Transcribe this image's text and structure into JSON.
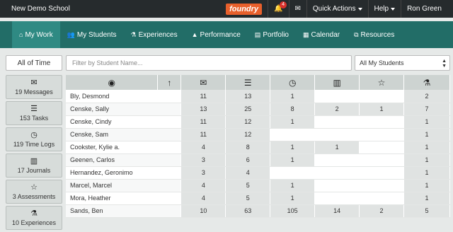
{
  "topbar": {
    "school": "New Demo School",
    "logo": "foundry",
    "notifications_count": "4",
    "quick_actions": "Quick Actions",
    "help": "Help",
    "user": "Ron Green"
  },
  "nav": {
    "tabs": [
      {
        "label": "My Work",
        "icon": "home-icon",
        "glyph": "⌂"
      },
      {
        "label": "My Students",
        "icon": "users-icon",
        "glyph": "👥"
      },
      {
        "label": "Experiences",
        "icon": "flask-icon",
        "glyph": "⚗"
      },
      {
        "label": "Performance",
        "icon": "chart-icon",
        "glyph": "▲"
      },
      {
        "label": "Portfolio",
        "icon": "book-icon",
        "glyph": "▤"
      },
      {
        "label": "Calendar",
        "icon": "calendar-icon",
        "glyph": "▦"
      },
      {
        "label": "Resources",
        "icon": "copy-icon",
        "glyph": "⧉"
      }
    ]
  },
  "filters": {
    "time_label": "All of Time",
    "student_placeholder": "Filter by Student Name...",
    "students_select": "All My Students"
  },
  "sidebar": {
    "items": [
      {
        "label": "19 Messages",
        "icon": "inbox-icon",
        "glyph": "✉"
      },
      {
        "label": "153 Tasks",
        "icon": "tasks-icon",
        "glyph": "☰"
      },
      {
        "label": "119 Time Logs",
        "icon": "clock-icon",
        "glyph": "◷"
      },
      {
        "label": "17 Journals",
        "icon": "journal-icon",
        "glyph": "▥"
      },
      {
        "label": "3 Assessments",
        "icon": "star-icon",
        "glyph": "☆"
      },
      {
        "label": "10 Experiences",
        "icon": "flask-icon",
        "glyph": "⚗"
      }
    ]
  },
  "table": {
    "columns": [
      {
        "icon": "user-icon",
        "glyph": "◉"
      },
      {
        "icon": "sort-up-icon",
        "glyph": "↑"
      },
      {
        "icon": "inbox-icon",
        "glyph": "✉"
      },
      {
        "icon": "tasks-icon",
        "glyph": "☰"
      },
      {
        "icon": "clock-icon",
        "glyph": "◷"
      },
      {
        "icon": "journal-icon",
        "glyph": "▥"
      },
      {
        "icon": "star-icon",
        "glyph": "☆"
      },
      {
        "icon": "flask-icon",
        "glyph": "⚗"
      }
    ],
    "rows": [
      {
        "name": "Bly, Desmond",
        "messages": "11",
        "tasks": "13",
        "timelogs": "1",
        "journals": "",
        "assessments": "",
        "experiences": "2"
      },
      {
        "name": "Censke, Sally",
        "messages": "13",
        "tasks": "25",
        "timelogs": "8",
        "journals": "2",
        "assessments": "1",
        "experiences": "7"
      },
      {
        "name": "Censke, Cindy",
        "messages": "11",
        "tasks": "12",
        "timelogs": "1",
        "journals": "",
        "assessments": "",
        "experiences": "1"
      },
      {
        "name": "Censke, Sam",
        "messages": "11",
        "tasks": "12",
        "timelogs": "",
        "journals": "",
        "assessments": "",
        "experiences": "1"
      },
      {
        "name": "Cookster, Kylie a.",
        "messages": "4",
        "tasks": "8",
        "timelogs": "1",
        "journals": "1",
        "assessments": "",
        "experiences": "1"
      },
      {
        "name": "Geenen, Carlos",
        "messages": "3",
        "tasks": "6",
        "timelogs": "1",
        "journals": "",
        "assessments": "",
        "experiences": "1"
      },
      {
        "name": "Hernandez, Geronimo",
        "messages": "3",
        "tasks": "4",
        "timelogs": "",
        "journals": "",
        "assessments": "",
        "experiences": "1"
      },
      {
        "name": "Marcel, Marcel",
        "messages": "4",
        "tasks": "5",
        "timelogs": "1",
        "journals": "",
        "assessments": "",
        "experiences": "1"
      },
      {
        "name": "Mora, Heather",
        "messages": "4",
        "tasks": "5",
        "timelogs": "1",
        "journals": "",
        "assessments": "",
        "experiences": "1"
      },
      {
        "name": "Sands, Ben",
        "messages": "10",
        "tasks": "63",
        "timelogs": "105",
        "journals": "14",
        "assessments": "2",
        "experiences": "5"
      }
    ]
  }
}
